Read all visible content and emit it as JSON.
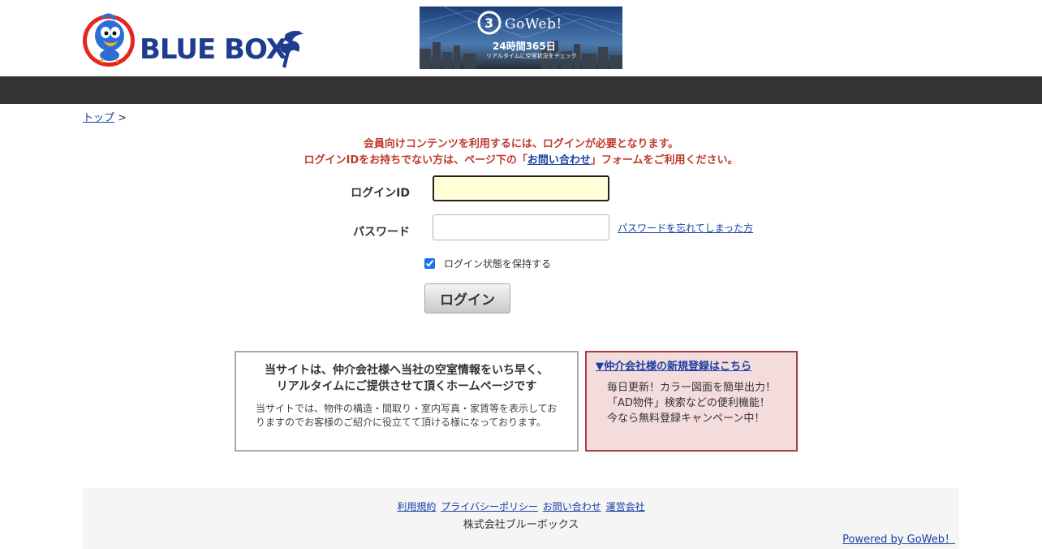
{
  "header": {
    "logo_text": "BLUE BOX",
    "banner": {
      "title": "GoWeb!",
      "subtitle": "24時間365日",
      "small": "リアルタイムに空室状況をチェック"
    }
  },
  "breadcrumb": {
    "home": "トップ",
    "separator": ">"
  },
  "notice": {
    "line1": "会員向けコンテンツを利用するには、ログインが必要となります。",
    "line2_pre": "ログインIDをお持ちでない方は、ページ下の「",
    "line2_link": "お問い合わせ",
    "line2_post": "」フォームをご利用ください。"
  },
  "login_form": {
    "id_label": "ログインID",
    "id_value": "",
    "password_label": "パスワード",
    "password_value": "",
    "forgot_link": "パスワードを忘れてしまった方",
    "remember_label": "ログイン状態を保持する",
    "remember_checked": true,
    "submit_label": "ログイン"
  },
  "info_box": {
    "title_line1": "当サイトは、仲介会社様へ当社の空室情報をいち早く、",
    "title_line2": "リアルタイムにご提供させて頂くホームページです",
    "body": "当サイトでは、物件の構造・間取り・室内写真・家賃等を表示しておりますのでお客様のご紹介に役立てて頂ける様になっております。"
  },
  "register_box": {
    "title": "▼仲介会社様の新規登録はこちら",
    "line1": "毎日更新！カラー図面を簡単出力！",
    "line2": "「AD物件」検索などの便利機能！",
    "line3": "今なら無料登録キャンペーン中！"
  },
  "footer": {
    "links": [
      "利用規約",
      "プライバシーポリシー",
      "お問い合わせ",
      "運営会社"
    ],
    "company": "株式会社ブルーボックス",
    "powered": "Powered by GoWeb！"
  },
  "colors": {
    "navbar": "#333333",
    "notice_red": "#c0392b",
    "link_blue": "#1a3fa3",
    "register_bg": "#f4dcdc",
    "register_border": "#a04040",
    "logo_blue": "#1e3d8f"
  }
}
